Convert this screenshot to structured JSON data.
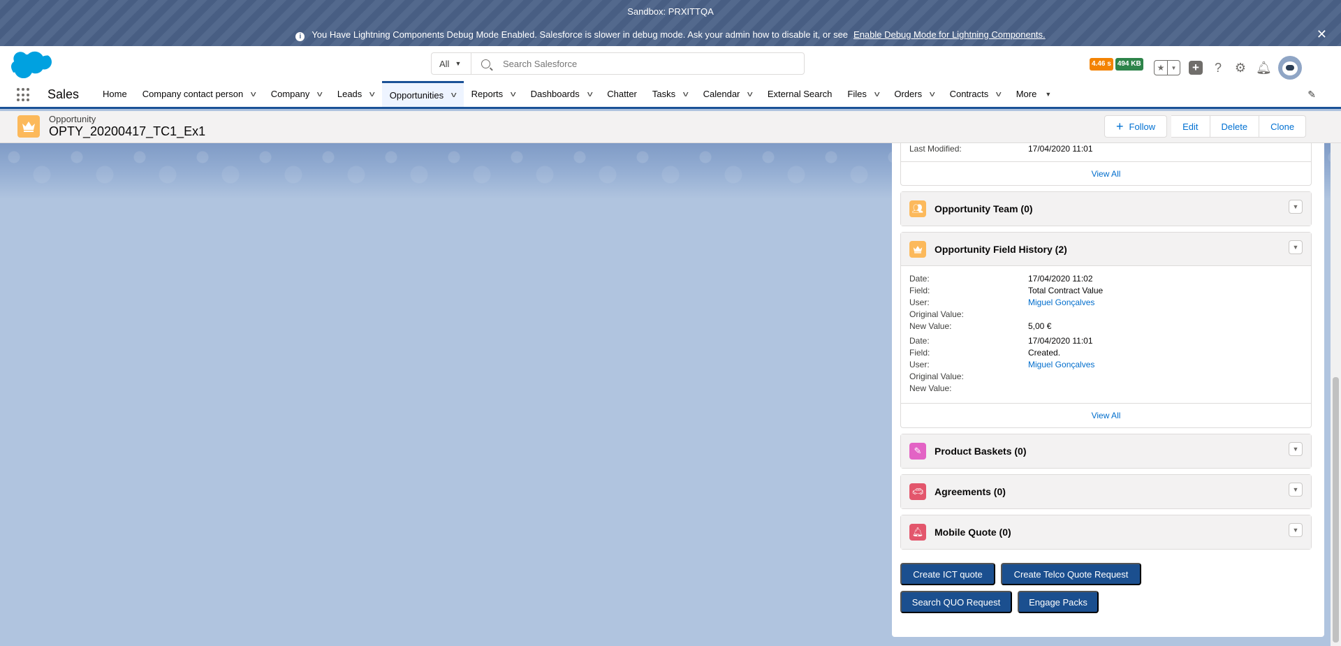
{
  "sandbox": {
    "title": "Sandbox: PRXITTQA",
    "debug_message": "You Have Lightning Components Debug Mode Enabled. Salesforce is slower in debug mode. Ask your admin how to disable it, or see",
    "debug_link": "Enable Debug Mode for Lightning Components.",
    "close": "✕"
  },
  "header": {
    "search_scope": "All",
    "search_placeholder": "Search Salesforce",
    "perf_time": "4.46 s",
    "perf_size": "494 KB",
    "colors": {
      "perf_time": "#f38303",
      "perf_size": "#2e844a",
      "brand": "#00a1e0"
    }
  },
  "nav": {
    "app_name": "Sales",
    "items": [
      {
        "label": "Home",
        "chevron": false
      },
      {
        "label": "Company contact person",
        "chevron": true
      },
      {
        "label": "Company",
        "chevron": true
      },
      {
        "label": "Leads",
        "chevron": true
      },
      {
        "label": "Opportunities",
        "chevron": true,
        "active": true
      },
      {
        "label": "Reports",
        "chevron": true
      },
      {
        "label": "Dashboards",
        "chevron": true
      },
      {
        "label": "Chatter",
        "chevron": false
      },
      {
        "label": "Tasks",
        "chevron": true
      },
      {
        "label": "Calendar",
        "chevron": true
      },
      {
        "label": "External Search",
        "chevron": false
      },
      {
        "label": "Files",
        "chevron": true
      },
      {
        "label": "Orders",
        "chevron": true
      },
      {
        "label": "Contracts",
        "chevron": true
      },
      {
        "label": "More",
        "chevron": true
      }
    ]
  },
  "record": {
    "type": "Opportunity",
    "name": "OPTY_20200417_TC1_Ex1",
    "actions": {
      "follow": "Follow",
      "edit": "Edit",
      "delete": "Delete",
      "clone": "Clone"
    }
  },
  "panel": {
    "top_card": {
      "last_modified_label": "Last Modified:",
      "last_modified_value": "17/04/2020 11:01",
      "view_all": "View All"
    },
    "team": {
      "title": "Opportunity Team (0)"
    },
    "history": {
      "title": "Opportunity Field History (2)",
      "entries": [
        {
          "date_label": "Date:",
          "date": "17/04/2020 11:02",
          "field_label": "Field:",
          "field": "Total Contract Value",
          "user_label": "User:",
          "user": "Miguel Gonçalves",
          "orig_label": "Original Value:",
          "orig": "",
          "new_label": "New Value:",
          "new": "5,00 €"
        },
        {
          "date_label": "Date:",
          "date": "17/04/2020 11:01",
          "field_label": "Field:",
          "field": "Created.",
          "user_label": "User:",
          "user": "Miguel Gonçalves",
          "orig_label": "Original Value:",
          "orig": "",
          "new_label": "New Value:",
          "new": ""
        }
      ],
      "view_all": "View All"
    },
    "baskets": {
      "title": "Product Baskets (0)"
    },
    "agreements": {
      "title": "Agreements (0)"
    },
    "mobile_quote": {
      "title": "Mobile Quote (0)"
    },
    "quote_buttons": {
      "ict": "Create ICT quote",
      "telco": "Create Telco Quote Request",
      "search": "Search QUO Request",
      "engage": "Engage Packs"
    }
  }
}
